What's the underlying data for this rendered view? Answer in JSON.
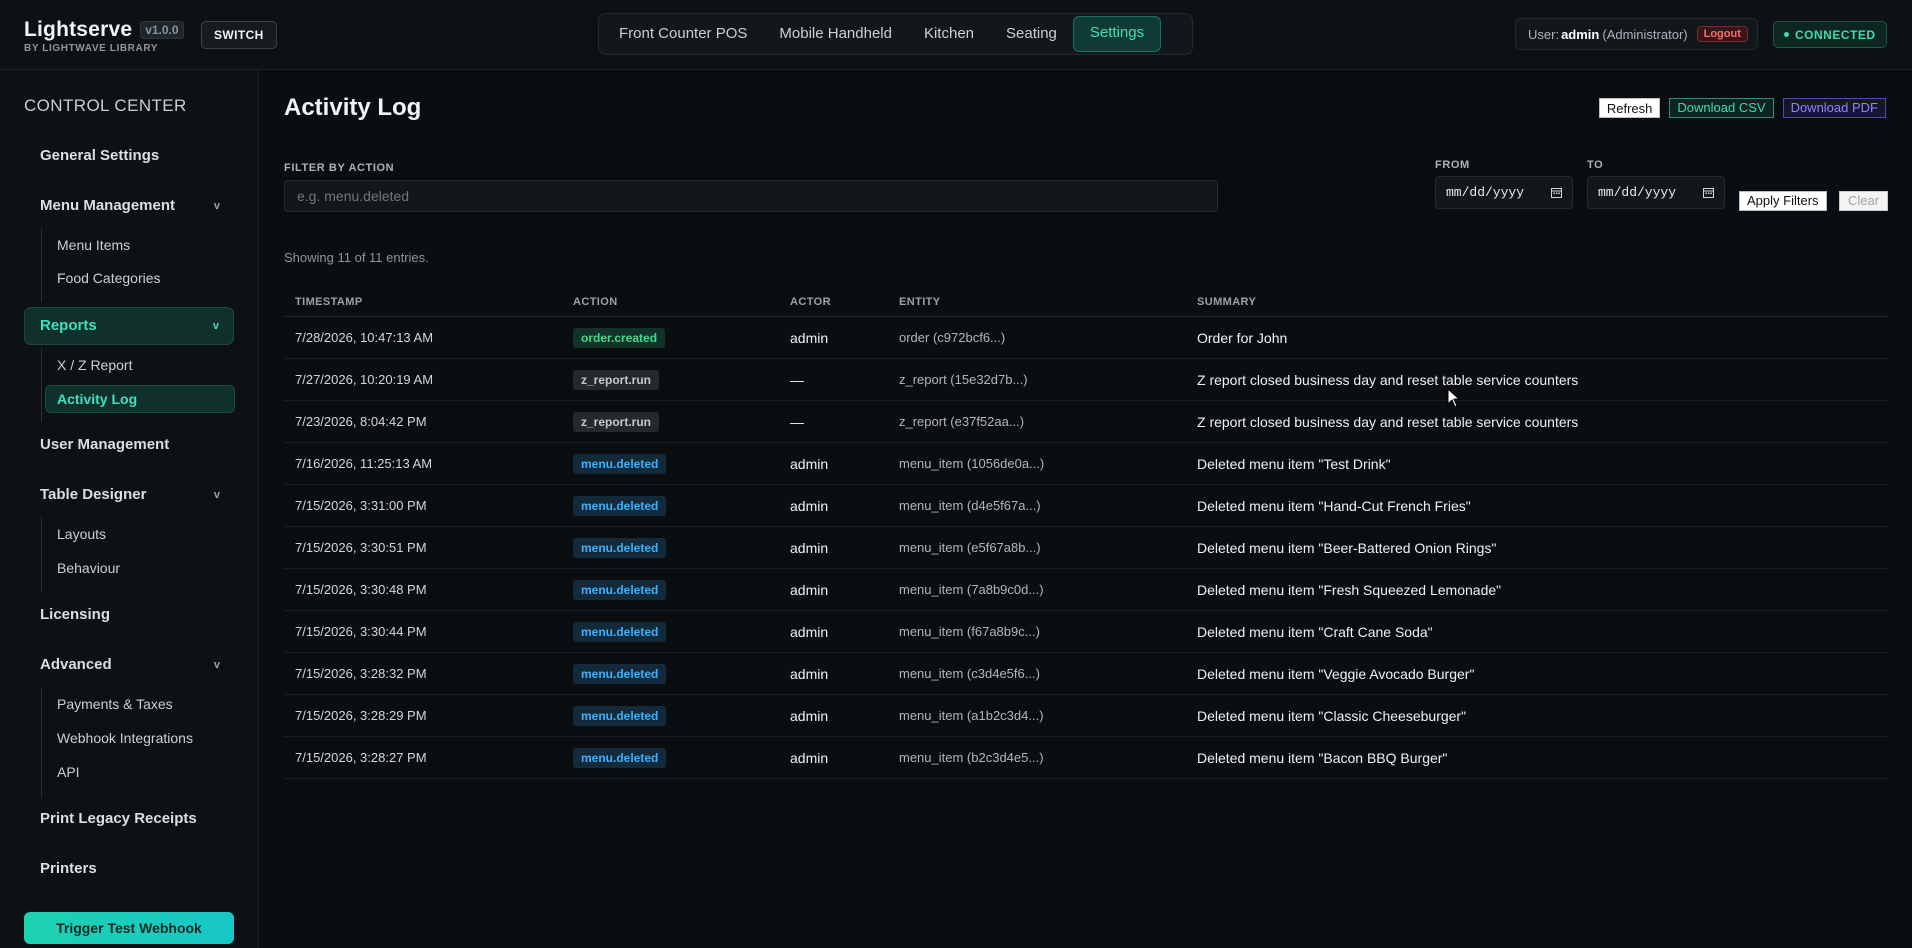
{
  "app": {
    "name": "Lightserve",
    "version": "v1.0.0",
    "subtitle": "BY LIGHTWAVE LIBRARY",
    "switch_label": "SWITCH"
  },
  "nav": {
    "tabs": [
      "Front Counter POS",
      "Mobile Handheld",
      "Kitchen",
      "Seating",
      "Settings"
    ],
    "active": "Settings"
  },
  "user": {
    "prefix": "User:",
    "name": "admin",
    "role": "(Administrator)",
    "logout_label": "Logout"
  },
  "status": {
    "label": "CONNECTED",
    "color": "#3fd9b2"
  },
  "sidebar": {
    "title": "CONTROL CENTER",
    "general_settings": "General Settings",
    "menu_management": "Menu Management",
    "menu_items": "Menu Items",
    "food_categories": "Food Categories",
    "reports": "Reports",
    "xz_report": "X / Z Report",
    "activity_log": "Activity Log",
    "user_management": "User Management",
    "table_designer": "Table Designer",
    "layouts": "Layouts",
    "behaviour": "Behaviour",
    "licensing": "Licensing",
    "advanced": "Advanced",
    "payments_taxes": "Payments & Taxes",
    "webhook_integrations": "Webhook Integrations",
    "api": "API",
    "print_legacy": "Print Legacy Receipts",
    "printers": "Printers",
    "trigger_webhook": "Trigger Test Webhook",
    "chevron": "v"
  },
  "page": {
    "title": "Activity Log",
    "refresh": "Refresh",
    "download_csv": "Download CSV",
    "download_pdf": "Download PDF"
  },
  "filters": {
    "action_label": "FILTER BY ACTION",
    "action_placeholder": "e.g. menu.deleted",
    "from_label": "FROM",
    "to_label": "TO",
    "date_placeholder": "mm/dd/yyyy",
    "apply": "Apply Filters",
    "clear": "Clear"
  },
  "showing": "Showing 11 of 11 entries.",
  "table": {
    "headers": [
      "TIMESTAMP",
      "ACTION",
      "ACTOR",
      "ENTITY",
      "SUMMARY"
    ],
    "rows": [
      {
        "ts": "7/28/2026, 10:47:13 AM",
        "action": "order.created",
        "kind": "order",
        "actor": "admin",
        "entity": "order (c972bcf6...)",
        "summary": "Order for John"
      },
      {
        "ts": "7/27/2026, 10:20:19 AM",
        "action": "z_report.run",
        "kind": "report",
        "actor": "—",
        "entity": "z_report (15e32d7b...)",
        "summary": "Z report closed business day and reset table service counters"
      },
      {
        "ts": "7/23/2026, 8:04:42 PM",
        "action": "z_report.run",
        "kind": "report",
        "actor": "—",
        "entity": "z_report (e37f52aa...)",
        "summary": "Z report closed business day and reset table service counters"
      },
      {
        "ts": "7/16/2026, 11:25:13 AM",
        "action": "menu.deleted",
        "kind": "menu",
        "actor": "admin",
        "entity": "menu_item (1056de0a...)",
        "summary": "Deleted menu item \"Test Drink\""
      },
      {
        "ts": "7/15/2026, 3:31:00 PM",
        "action": "menu.deleted",
        "kind": "menu",
        "actor": "admin",
        "entity": "menu_item (d4e5f67a...)",
        "summary": "Deleted menu item \"Hand-Cut French Fries\""
      },
      {
        "ts": "7/15/2026, 3:30:51 PM",
        "action": "menu.deleted",
        "kind": "menu",
        "actor": "admin",
        "entity": "menu_item (e5f67a8b...)",
        "summary": "Deleted menu item \"Beer-Battered Onion Rings\""
      },
      {
        "ts": "7/15/2026, 3:30:48 PM",
        "action": "menu.deleted",
        "kind": "menu",
        "actor": "admin",
        "entity": "menu_item (7a8b9c0d...)",
        "summary": "Deleted menu item \"Fresh Squeezed Lemonade\""
      },
      {
        "ts": "7/15/2026, 3:30:44 PM",
        "action": "menu.deleted",
        "kind": "menu",
        "actor": "admin",
        "entity": "menu_item (f67a8b9c...)",
        "summary": "Deleted menu item \"Craft Cane Soda\""
      },
      {
        "ts": "7/15/2026, 3:28:32 PM",
        "action": "menu.deleted",
        "kind": "menu",
        "actor": "admin",
        "entity": "menu_item (c3d4e5f6...)",
        "summary": "Deleted menu item \"Veggie Avocado Burger\""
      },
      {
        "ts": "7/15/2026, 3:28:29 PM",
        "action": "menu.deleted",
        "kind": "menu",
        "actor": "admin",
        "entity": "menu_item (a1b2c3d4...)",
        "summary": "Deleted menu item \"Classic Cheeseburger\""
      },
      {
        "ts": "7/15/2026, 3:28:27 PM",
        "action": "menu.deleted",
        "kind": "menu",
        "actor": "admin",
        "entity": "menu_item (b2c3d4e5...)",
        "summary": "Deleted menu item \"Bacon BBQ Burger\""
      }
    ]
  },
  "icons": {
    "calendar": "calendar-icon",
    "chevron": "chevron-down-icon",
    "status_dot": "status-dot-icon",
    "cursor": "mouse-cursor-icon"
  }
}
